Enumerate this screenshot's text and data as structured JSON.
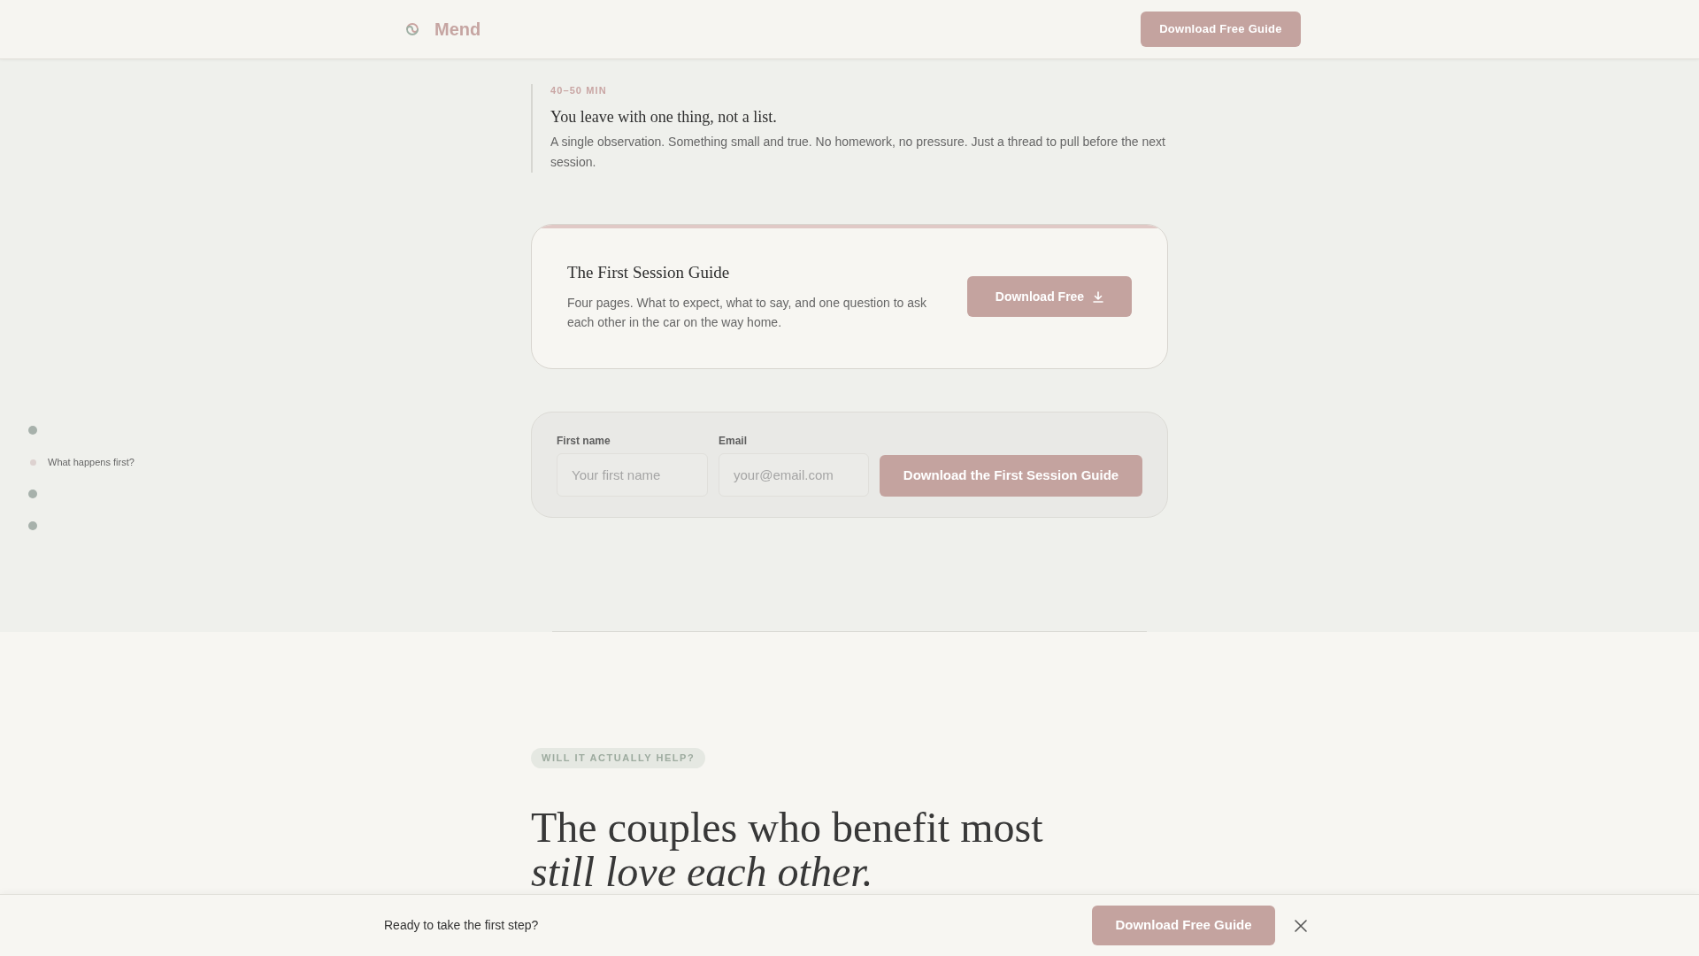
{
  "header": {
    "logo": "Mend",
    "button": "Download Free Guide"
  },
  "side_nav": [
    {
      "selected": false
    },
    {
      "selected": true,
      "label": "What happens first?"
    },
    {
      "selected": false
    },
    {
      "selected": false
    }
  ],
  "step": {
    "time": "40–50 MIN",
    "title": "You leave with one thing, not a list.",
    "text": "A single observation. Something small and true. No homework, no pressure. Just a thread to pull before the next session."
  },
  "guide_card": {
    "title": "The First Session Guide",
    "text": "Four pages. What to expect, what to say, and one question to ask each other in the car on the way home.",
    "button": "Download Free"
  },
  "signup_form": {
    "fields": [
      {
        "label": "First name",
        "placeholder": "Your first name"
      },
      {
        "label": "Email",
        "placeholder": "your@email.com"
      }
    ],
    "button": "Download the First Session Guide"
  },
  "section": {
    "badge": "WILL IT ACTUALLY HELP?",
    "heading": "The couples who benefit most *still love each other.*"
  },
  "sticky_bar": {
    "text": "Ready to take the first step?",
    "button": "Download Free Guide"
  }
}
